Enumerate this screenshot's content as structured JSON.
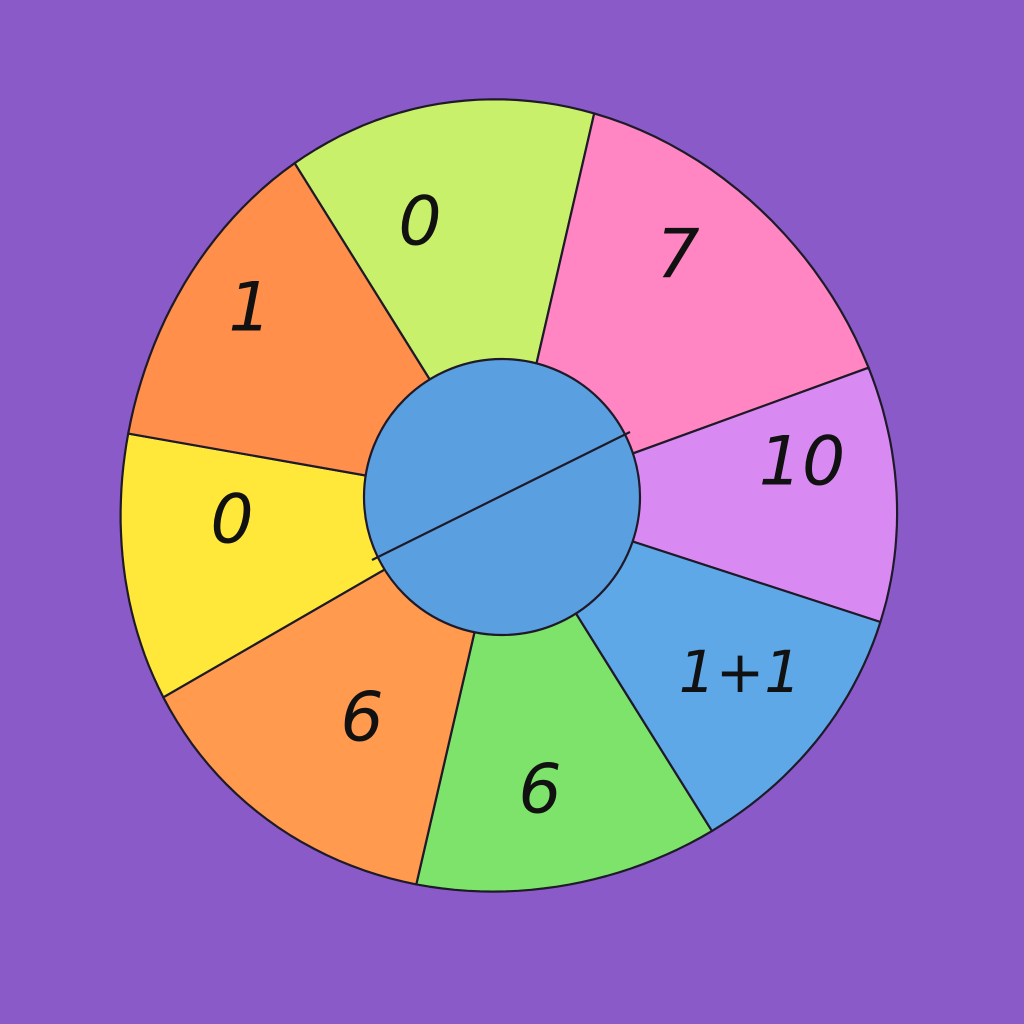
{
  "spinner": {
    "background_color": "#8a5bc8",
    "hub_color": "#5aa0e0",
    "segments": [
      {
        "label": "0",
        "color": "#c8f06a"
      },
      {
        "label": "7",
        "color": "#ff86c2"
      },
      {
        "label": "10",
        "color": "#d98af2"
      },
      {
        "label": "1+1",
        "color": "#5fa8e8"
      },
      {
        "label": "6",
        "color": "#7ee36a"
      },
      {
        "label": "6",
        "color": "#ff9a4e"
      },
      {
        "label": "0",
        "color": "#ffe83a"
      },
      {
        "label": "1",
        "color": "#ff8f4a"
      }
    ]
  }
}
